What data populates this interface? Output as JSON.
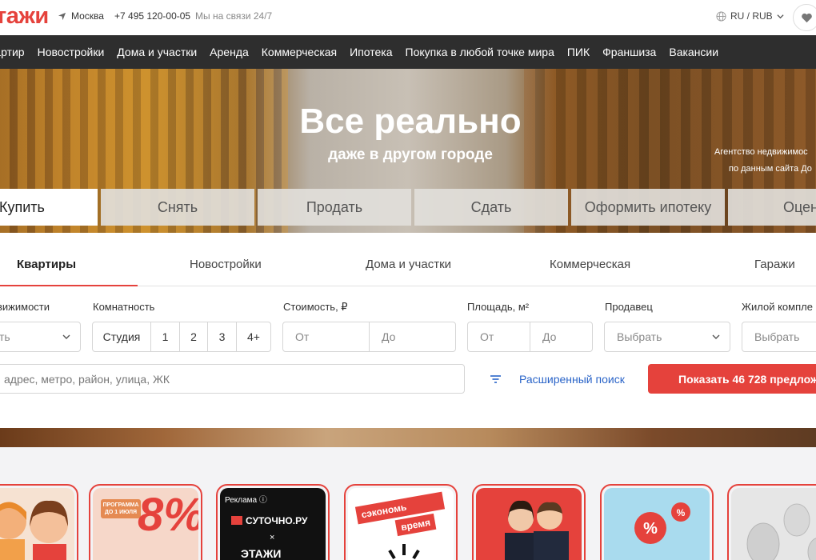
{
  "header": {
    "logo": "тажи",
    "city": "Москва",
    "phone": "+7 495 120-00-05",
    "support": "Мы на связи 24/7",
    "lang": "RU / RUB"
  },
  "nav": [
    "вартир",
    "Новостройки",
    "Дома и участки",
    "Аренда",
    "Коммерческая",
    "Ипотека",
    "Покупка в любой точке мира",
    "ПИК",
    "Франшиза",
    "Вакансии"
  ],
  "hero": {
    "title": "Все реально",
    "subtitle": "даже в другом городе",
    "agency_line1": "Агентство недвижимос",
    "agency_line2": "по данным сайта До"
  },
  "deal_tabs": [
    "Купить",
    "Снять",
    "Продать",
    "Сдать",
    "Оформить ипотеку",
    "Оцени"
  ],
  "property_tabs": [
    "Квартиры",
    "Новостройки",
    "Дома и участки",
    "Коммерческая",
    "Гаражи"
  ],
  "filters": {
    "type_label": "вижимости",
    "type_value": "ть",
    "rooms_label": "Комнатность",
    "rooms": [
      "Студия",
      "1",
      "2",
      "3",
      "4+"
    ],
    "price_label": "Стоимость, ₽",
    "price_from": "От",
    "price_to": "До",
    "area_label": "Площадь, м²",
    "area_from": "От",
    "area_to": "До",
    "seller_label": "Продавец",
    "seller_value": "Выбрать",
    "complex_label": "Жилой компле",
    "complex_value": "Выбрать",
    "address_placeholder": "адрес, метро, район, улица, ЖК",
    "advanced_search": "Расширенный поиск",
    "show_button": "Показать 46 728 предложе"
  },
  "stories": {
    "promo": "ПРОГРАММА ДО 1 ИЮЛЯ",
    "eight": "8%",
    "ad_label": "Реклама ⓘ",
    "brand1": "СУТОЧНО.РУ",
    "times": "×",
    "brand2": "ЭТАЖИ",
    "save_1": "сэкономь",
    "save_2": "время"
  },
  "colors": {
    "accent": "#e5423c",
    "nav_bg": "#2e2e2e",
    "link": "#2a64c8"
  }
}
